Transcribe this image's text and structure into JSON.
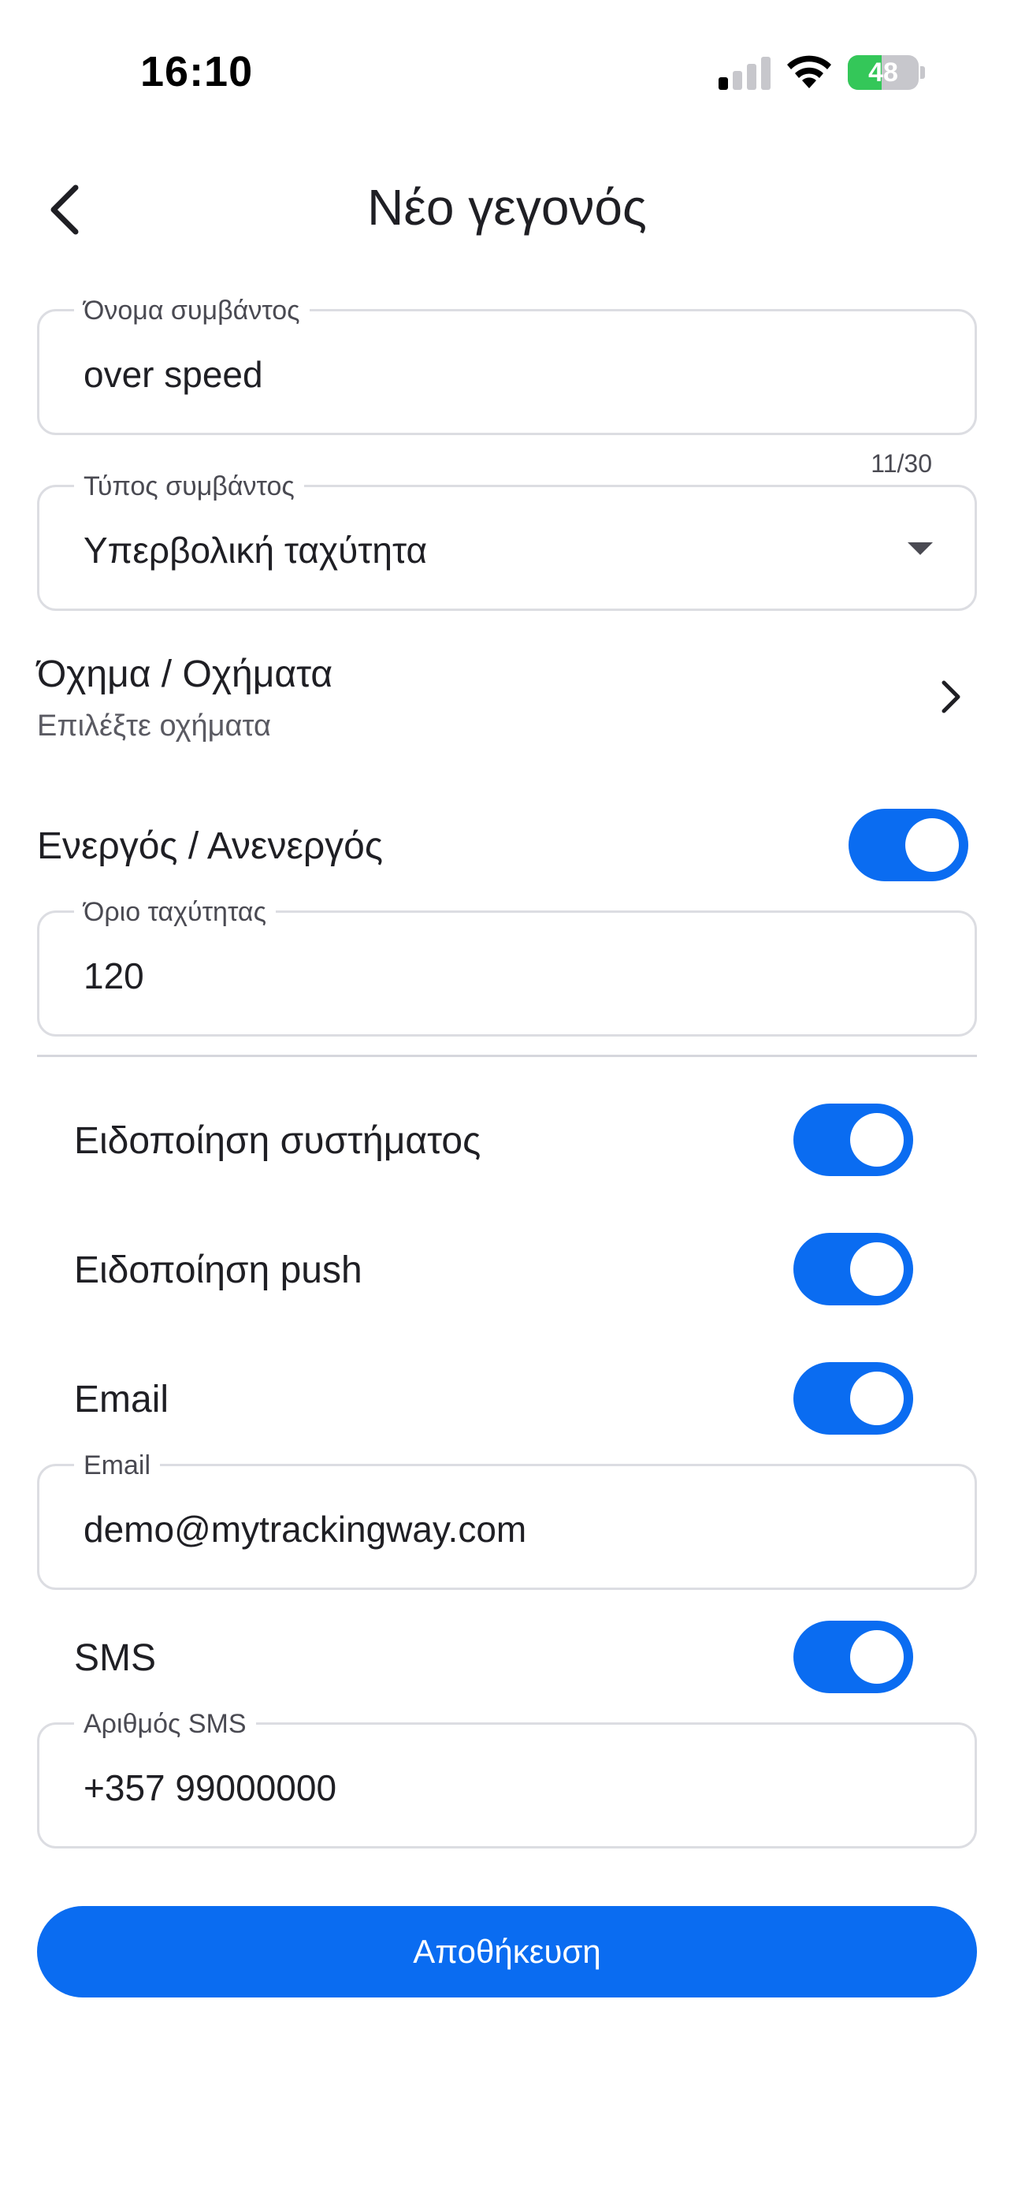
{
  "status_bar": {
    "time": "16:10",
    "battery": "48",
    "battery_level": 0.48
  },
  "header": {
    "title": "Νέο γεγονός",
    "back_icon": "chevron-left-icon"
  },
  "event_name": {
    "label": "Όνομα συμβάντος",
    "value": "over speed",
    "counter": "11/30"
  },
  "event_type": {
    "label": "Τύπος συμβάντος",
    "value": "Υπερβολική ταχύτητα"
  },
  "vehicles": {
    "title": "Όχημα / Οχήματα",
    "subtitle": "Επιλέξτε οχήματα"
  },
  "active": {
    "label": "Ενεργός / Ανενεργός",
    "on": true
  },
  "speed_limit": {
    "label": "Όριο ταχύτητας",
    "value": "120"
  },
  "notifications": {
    "system": {
      "label": "Ειδοποίηση συστήματος",
      "on": true
    },
    "push": {
      "label": "Ειδοποίηση push",
      "on": true
    },
    "email": {
      "label": "Email",
      "on": true
    },
    "email_field": {
      "label": "Email",
      "value": "demo@mytrackingway.com"
    },
    "sms": {
      "label": "SMS",
      "on": true
    },
    "sms_field": {
      "label": "Αριθμός SMS",
      "value": "+357 99000000"
    }
  },
  "save_button": {
    "label": "Αποθήκευση"
  },
  "colors": {
    "accent": "#0a6cf1",
    "battery": "#34c759",
    "field_border": "#dcdde2"
  }
}
